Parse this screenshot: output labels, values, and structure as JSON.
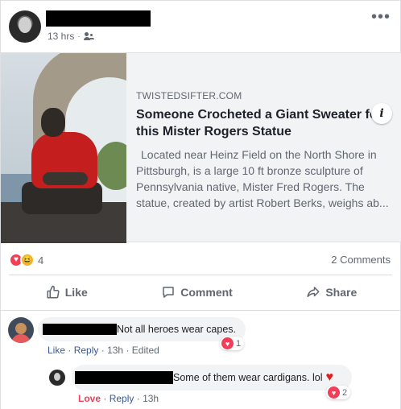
{
  "post": {
    "time": "13 hrs",
    "privacy_icon": "friends-icon",
    "more_icon": "more-options-icon"
  },
  "link_preview": {
    "domain": "TWISTEDSIFTER.COM",
    "title": "Someone Crocheted a Giant Sweater for this Mister Rogers Statue",
    "description": "Located near Heinz Field on the North Shore in Pittsburgh, is a large 10 ft bronze sculpture of Pennsylvania native, Mister Fred Rogers. The statue, created by artist Robert Berks, weighs ab...",
    "info_label": "i"
  },
  "engagement": {
    "reaction_count": "4",
    "comments_count": "2 Comments"
  },
  "actions": {
    "like": "Like",
    "comment": "Comment",
    "share": "Share"
  },
  "comments": [
    {
      "text": "Not all heroes wear capes.",
      "like": "Like",
      "reply": "Reply",
      "time": "13h",
      "edited": "Edited",
      "reaction_count": "1"
    },
    {
      "text": "Some of them wear cardigans. lol",
      "like": "Love",
      "reply": "Reply",
      "time": "13h",
      "reaction_count": "2"
    }
  ],
  "colors": {
    "link": "#385898",
    "secondary_text": "#606770",
    "love": "#f33e58",
    "haha": "#f7b125"
  }
}
